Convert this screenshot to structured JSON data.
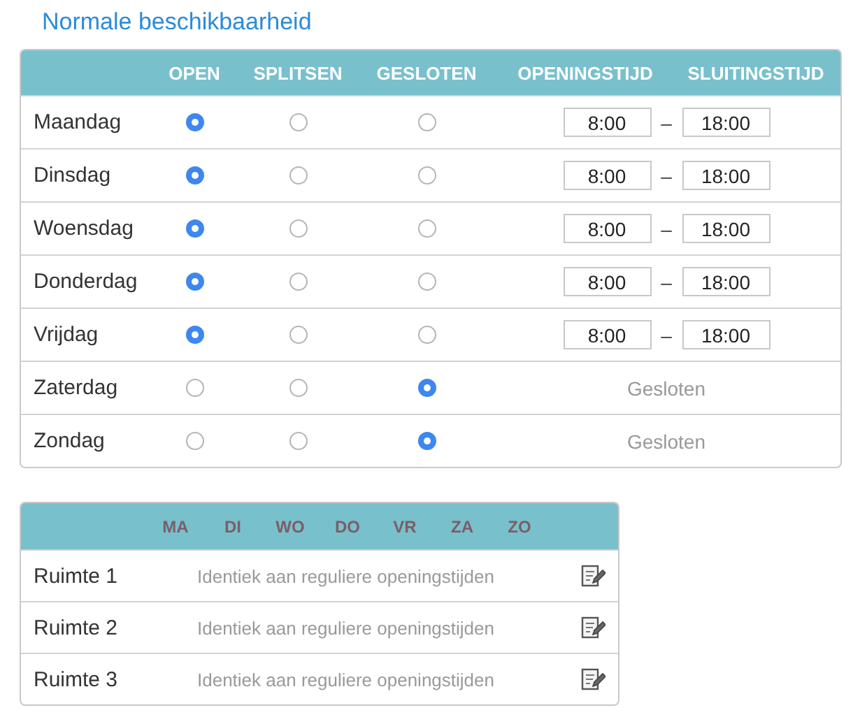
{
  "title": "Normale beschikbaarheid",
  "schedule": {
    "columns": [
      "OPEN",
      "SPLITSEN",
      "GESLOTEN",
      "OPENINGSTIJD",
      "SLUITINGSTIJD"
    ],
    "days": [
      {
        "name": "Maandag",
        "options": [
          {
            "selected": true
          },
          {
            "selected": false
          },
          {
            "selected": false
          }
        ],
        "opening": "8:00",
        "separator": "–",
        "closing": "18:00"
      },
      {
        "name": "Dinsdag",
        "options": [
          {
            "selected": true
          },
          {
            "selected": false
          },
          {
            "selected": false
          }
        ],
        "opening": "8:00",
        "separator": "–",
        "closing": "18:00"
      },
      {
        "name": "Woensdag",
        "options": [
          {
            "selected": true
          },
          {
            "selected": false
          },
          {
            "selected": false
          }
        ],
        "opening": "8:00",
        "separator": "–",
        "closing": "18:00"
      },
      {
        "name": "Donderdag",
        "options": [
          {
            "selected": true
          },
          {
            "selected": false
          },
          {
            "selected": false
          }
        ],
        "opening": "8:00",
        "separator": "–",
        "closing": "18:00"
      },
      {
        "name": "Vrijdag",
        "options": [
          {
            "selected": true
          },
          {
            "selected": false
          },
          {
            "selected": false
          }
        ],
        "opening": "8:00",
        "separator": "–",
        "closing": "18:00"
      },
      {
        "name": "Zaterdag",
        "options": [
          {
            "selected": false
          },
          {
            "selected": false
          },
          {
            "selected": true
          }
        ],
        "status": "Gesloten"
      },
      {
        "name": "Zondag",
        "options": [
          {
            "selected": false
          },
          {
            "selected": false
          },
          {
            "selected": true
          }
        ],
        "status": "Gesloten"
      }
    ]
  },
  "rooms": {
    "columns": [
      "MA",
      "DI",
      "WO",
      "DO",
      "VR",
      "ZA",
      "ZO"
    ],
    "rows": [
      {
        "name": "Ruimte 1",
        "description": "Identiek aan reguliere openingstijden"
      },
      {
        "name": "Ruimte 2",
        "description": "Identiek aan reguliere openingstijden"
      },
      {
        "name": "Ruimte 3",
        "description": "Identiek aan reguliere openingstijden"
      }
    ]
  }
}
